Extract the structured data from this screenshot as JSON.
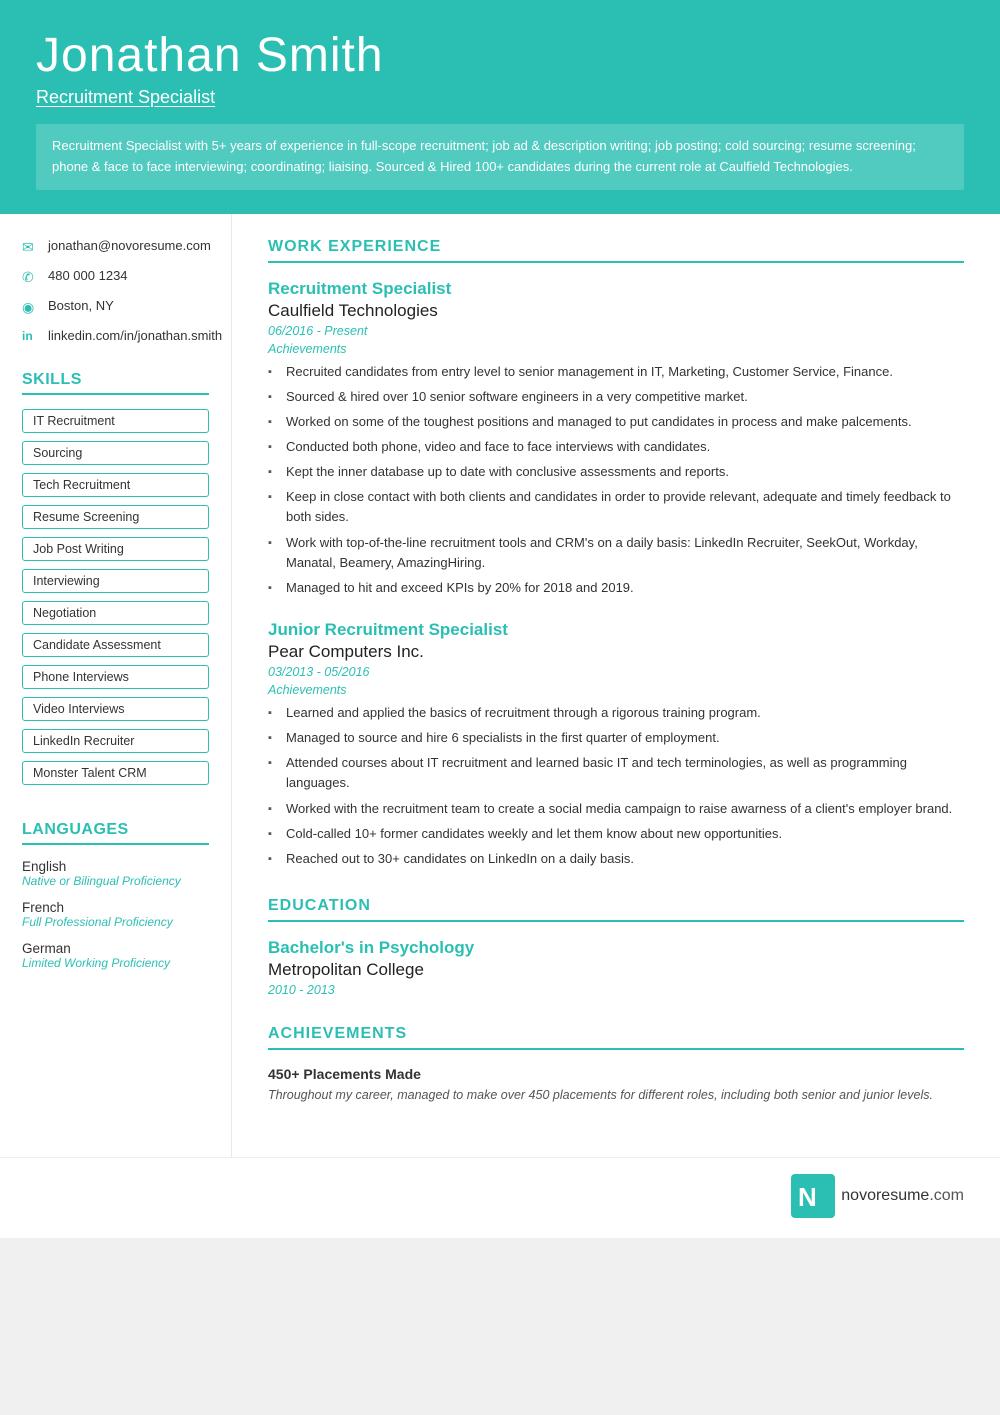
{
  "header": {
    "name": "Jonathan Smith",
    "title": "Recruitment Specialist",
    "summary": "Recruitment Specialist with 5+ years of experience in full-scope recruitment; job ad & description writing; job posting; cold sourcing; resume screening; phone & face to face interviewing; coordinating; liaising. Sourced & Hired 100+ candidates during the current role at Caulfield Technologies."
  },
  "contact": {
    "email": "jonathan@novoresume.com",
    "phone": "480 000 1234",
    "location": "Boston, NY",
    "linkedin": "linkedin.com/in/jonathan.smith"
  },
  "skills": {
    "title": "SKILLS",
    "items": [
      "IT Recruitment",
      "Sourcing",
      "Tech Recruitment",
      "Resume Screening",
      "Job Post Writing",
      "Interviewing",
      "Negotiation",
      "Candidate Assessment",
      "Phone Interviews",
      "Video Interviews",
      "LinkedIn Recruiter",
      "Monster Talent CRM"
    ]
  },
  "languages": {
    "title": "LANGUAGES",
    "items": [
      {
        "name": "English",
        "level": "Native or Bilingual Proficiency"
      },
      {
        "name": "French",
        "level": "Full Professional Proficiency"
      },
      {
        "name": "German",
        "level": "Limited Working Proficiency"
      }
    ]
  },
  "work_experience": {
    "title": "WORK EXPERIENCE",
    "jobs": [
      {
        "title": "Recruitment Specialist",
        "company": "Caulfield Technologies",
        "dates": "06/2016 - Present",
        "achievements_label": "Achievements",
        "bullets": [
          "Recruited candidates from entry level to senior management in IT, Marketing, Customer Service, Finance.",
          "Sourced & hired over 10 senior software engineers in a very competitive market.",
          "Worked on some of the toughest positions and managed to put candidates in process and make palcements.",
          "Conducted both phone, video and face to face interviews with candidates.",
          "Kept the inner database up to date with conclusive assessments and reports.",
          "Keep in close contact with both clients and candidates in order to provide relevant, adequate and timely feedback to both sides.",
          "Work with top-of-the-line recruitment tools and CRM's on a daily basis: LinkedIn Recruiter, SeekOut, Workday, Manatal, Beamery, AmazingHiring.",
          "Managed to hit and exceed KPIs by 20% for 2018 and 2019."
        ]
      },
      {
        "title": "Junior Recruitment Specialist",
        "company": "Pear Computers Inc.",
        "dates": "03/2013 - 05/2016",
        "achievements_label": "Achievements",
        "bullets": [
          "Learned and applied the basics of recruitment through a rigorous training program.",
          "Managed to source and hire 6 specialists in the first quarter of employment.",
          "Attended courses about IT recruitment and learned basic IT and tech terminologies, as well as programming languages.",
          "Worked with the recruitment team to create a social media campaign to raise awarness of a client's employer brand.",
          "Cold-called 10+ former candidates weekly and let them know about new opportunities.",
          "Reached out to 30+ candidates on LinkedIn on a daily basis."
        ]
      }
    ]
  },
  "education": {
    "title": "EDUCATION",
    "entries": [
      {
        "degree": "Bachelor's in Psychology",
        "school": "Metropolitan College",
        "dates": "2010 - 2013"
      }
    ]
  },
  "achievements": {
    "title": "ACHIEVEMENTS",
    "items": [
      {
        "name": "450+ Placements Made",
        "description": "Throughout my career, managed to make over 450 placements for different roles, including both senior and junior levels."
      }
    ]
  },
  "footer": {
    "logo_text": "novoresume",
    "logo_domain": ".com"
  }
}
